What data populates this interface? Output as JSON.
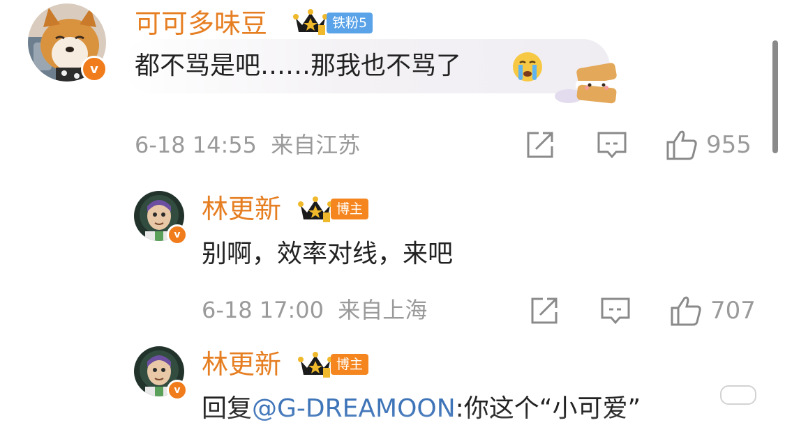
{
  "comments": [
    {
      "username": "可可多味豆",
      "badge": "铁粉5",
      "text": "都不骂是吧……那我也不骂了",
      "time": "6-18 14:55",
      "location": "来自江苏",
      "likes": "955"
    },
    {
      "username": "林更新",
      "badge": "博主",
      "text": "别啊，效率对线，来吧",
      "time": "6-18 17:00",
      "location": "来自上海",
      "likes": "707"
    },
    {
      "username": "林更新",
      "badge": "博主",
      "reply_prefix": "回复",
      "mention": "@G-DREAMOON",
      "text_after": ":你这个“小可爱”"
    }
  ],
  "icons": {
    "verified": "v-verified-icon",
    "crown": "crown-rank-icon",
    "crying_emoji": "crying-emoji-icon",
    "biscuit_sticker": "biscuit-sticker-icon",
    "share": "share-icon",
    "comment": "comment-icon",
    "like": "thumbs-up-icon"
  },
  "colors": {
    "username": "#e67e22",
    "mention": "#3e74b8",
    "meta": "#9a9a9a",
    "fan_badge": "#5aa3e8",
    "host_badge": "#f5861f",
    "verified": "#f07c1c"
  }
}
